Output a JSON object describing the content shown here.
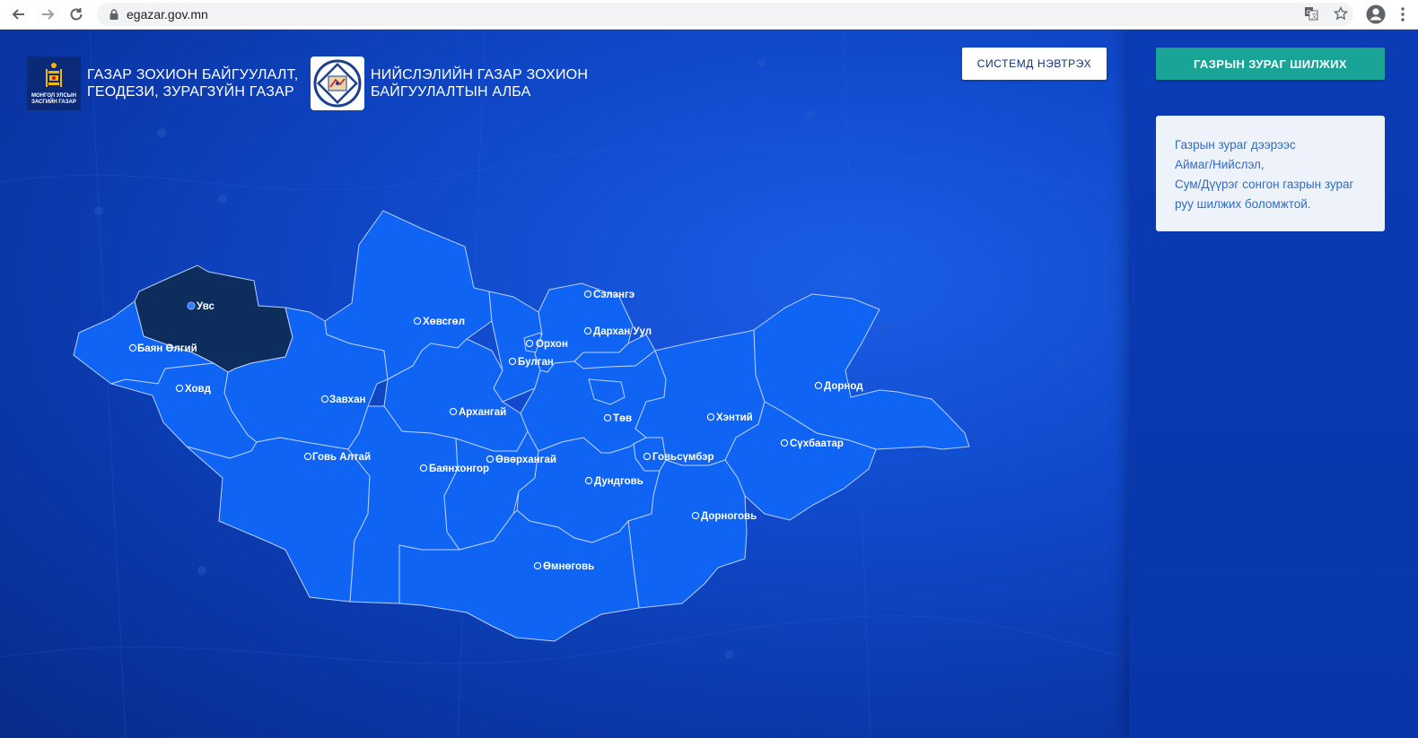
{
  "browser": {
    "url": "egazar.gov.mn",
    "icons": {
      "back": "arrow-left-icon",
      "forward": "arrow-right-icon",
      "reload": "reload-icon",
      "lock": "lock-icon",
      "translate": "translate-icon",
      "bookmark": "star-icon",
      "profile": "account-icon",
      "menu": "kebab-menu-icon"
    }
  },
  "header": {
    "org1": {
      "logo_text": "МОНГОЛ УЛСЫН ЗАСГИЙН ГАЗАР",
      "name_line1": "ГАЗАР ЗОХИОН БАЙГУУЛАЛТ,",
      "name_line2": "ГЕОДЕЗИ, ЗУРАГЗҮЙН ГАЗАР"
    },
    "org2": {
      "name_line1": "НИЙСЛЭЛИЙН ГАЗАР ЗОХИОН",
      "name_line2": "БАЙГУУЛАЛТЫН АЛБА"
    },
    "login_label": "СИСТЕМД НЭВТРЭХ"
  },
  "side_panel": {
    "switch_label": "ГАЗРЫН ЗУРАГ ШИЛЖИХ",
    "info_lines": [
      "Газрын зураг дээрээс",
      "Аймаг/Нийслэл,",
      "Сум/Дүүрэг сонгон газрын зураг",
      "руу шилжих боломжтой."
    ]
  },
  "map": {
    "selected": "Увс",
    "colors": {
      "region": "#0f64f3",
      "selected": "#0d2d5c",
      "border": "#b9d0ff"
    },
    "regions": [
      {
        "id": "uvs",
        "label": "Увс"
      },
      {
        "id": "bayan-ulgii",
        "label": "Баян Өлгий"
      },
      {
        "id": "khovd",
        "label": "Ховд"
      },
      {
        "id": "zavkhan",
        "label": "Завхан"
      },
      {
        "id": "khuvsgul",
        "label": "Хөвсгөл"
      },
      {
        "id": "gobi-altai",
        "label": "Говь Алтай"
      },
      {
        "id": "arkhangai",
        "label": "Архангай"
      },
      {
        "id": "bulgan",
        "label": "Булган"
      },
      {
        "id": "orkhon",
        "label": "Орхон"
      },
      {
        "id": "selenge",
        "label": "Сэлэнгэ"
      },
      {
        "id": "darkhan-uul",
        "label": "Дархан Уул"
      },
      {
        "id": "tuv",
        "label": "Төв"
      },
      {
        "id": "khentii",
        "label": "Хэнтий"
      },
      {
        "id": "dornod",
        "label": "Дорнод"
      },
      {
        "id": "sukhbaatar",
        "label": "Сүхбаатар"
      },
      {
        "id": "govisumber",
        "label": "Говьсүмбэр"
      },
      {
        "id": "bayankhongor",
        "label": "Баянхонгор"
      },
      {
        "id": "uvurkhangai",
        "label": "Өвөрхангай"
      },
      {
        "id": "dundgovi",
        "label": "Дундговь"
      },
      {
        "id": "dornogovi",
        "label": "Дорноговь"
      },
      {
        "id": "umnugovi",
        "label": "Өмнөговь"
      }
    ]
  }
}
